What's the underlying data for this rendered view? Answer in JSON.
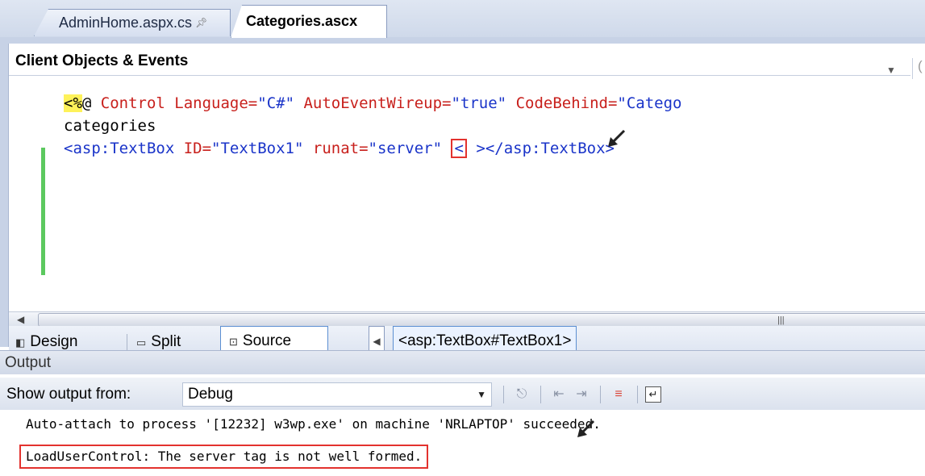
{
  "tabs": [
    {
      "label": "AdminHome.aspx.cs",
      "active": false
    },
    {
      "label": "Categories.ascx",
      "active": true
    }
  ],
  "editor": {
    "client_objects_dropdown": "Client Objects & Events",
    "code_lines": {
      "line1_delim": "<%",
      "line1_rest_a": "@ ",
      "line1_control": "Control ",
      "line1_lang_attr": "Language=",
      "line1_lang_val": "\"C#\"",
      "line1_auto_attr": " AutoEventWireup=",
      "line1_auto_val": "\"true\"",
      "line1_code_attr": " CodeBehind=",
      "line1_code_val": "\"Catego",
      "line2": "categories",
      "line3_tag": "<asp:TextBox",
      "line3_id_attr": " ID=",
      "line3_id_val": "\"TextBox1\"",
      "line3_runat_attr": " runat=",
      "line3_runat_val": "\"server\"",
      "line3_error_char": "<",
      "line3_close": "></asp:TextBox>"
    }
  },
  "view_bar": {
    "design_label": "Design",
    "split_label": "Split",
    "source_label": "Source",
    "tag_breadcrumb": "<asp:TextBox#TextBox1>"
  },
  "output": {
    "panel_title": "Output",
    "show_from_label": "Show output from:",
    "show_from_value": "Debug",
    "lines": [
      "Auto-attach to process '[12232] w3wp.exe' on machine 'NRLAPTOP' succeeded.",
      "LoadUserControl: The server tag is not well formed."
    ]
  },
  "icons": {
    "pin": "pin-icon",
    "design": "design-view-icon",
    "split": "split-view-icon",
    "source": "source-view-icon",
    "tag_nav": "tag-nav-left-icon",
    "find_message": "find-message-icon",
    "prev_message": "prev-message-icon",
    "next_message": "next-message-icon",
    "clear_all": "clear-all-icon",
    "word_wrap": "word-wrap-icon"
  },
  "colors": {
    "error_box": "#e3322e",
    "change_marker": "#5cc95f",
    "asp_delimiter_bg": "#fef25a",
    "html_keyword": "#1a34c9",
    "attribute": "#c8201c"
  }
}
